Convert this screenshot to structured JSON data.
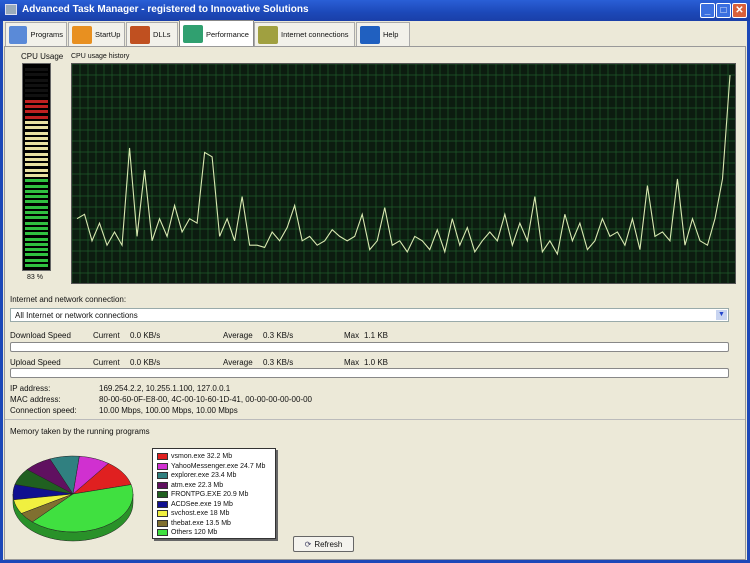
{
  "window": {
    "title": "Advanced Task Manager - registered to Innovative Solutions",
    "minimize": "_",
    "maximize": "□",
    "close": "✕"
  },
  "tabs": [
    {
      "label": "Programs",
      "icon": "window-icon",
      "color": "#5a8ad8"
    },
    {
      "label": "StartUp",
      "icon": "rocket-icon",
      "color": "#e89020"
    },
    {
      "label": "DLLs",
      "icon": "molecule-icon",
      "color": "#c05020"
    },
    {
      "label": "Performance",
      "icon": "bar-chart-icon",
      "color": "#30a070"
    },
    {
      "label": "Internet connections",
      "icon": "network-icon",
      "color": "#a0a040"
    },
    {
      "label": "Help",
      "icon": "book-icon",
      "color": "#2060c0"
    }
  ],
  "cpu": {
    "label": "CPU Usage",
    "value_text": "83 %",
    "value": 83,
    "history_label": "CPU usage history",
    "history": [
      30,
      32,
      20,
      28,
      18,
      24,
      18,
      62,
      22,
      52,
      20,
      30,
      22,
      36,
      24,
      30,
      28,
      60,
      58,
      22,
      30,
      20,
      40,
      18,
      18,
      17,
      24,
      20,
      26,
      36,
      20,
      22,
      18,
      20,
      25,
      22,
      20,
      22,
      32,
      16,
      20,
      35,
      18,
      20,
      15,
      22,
      20,
      16,
      25,
      15,
      30,
      18,
      26,
      15,
      20,
      24,
      20,
      32,
      18,
      28,
      20,
      40,
      15,
      20,
      14,
      32,
      20,
      28,
      16,
      20,
      30,
      22,
      24,
      18,
      30,
      16,
      45,
      22,
      24,
      20,
      48,
      18,
      30,
      20,
      18,
      30,
      48,
      95
    ]
  },
  "network": {
    "label": "Internet and network connection:",
    "selected": "All Internet or network connections",
    "download": {
      "label": "Download Speed",
      "current_label": "Current",
      "current": "0.0 KB/s",
      "average_label": "Average",
      "average": "0.3 KB/s",
      "max_label": "Max",
      "max": "1.1 KB",
      "progress": 0
    },
    "upload": {
      "label": "Upload Speed",
      "current_label": "Current",
      "current": "0.0 KB/s",
      "average_label": "Average",
      "average": "0.3 KB/s",
      "max_label": "Max",
      "max": "1.0 KB",
      "progress": 0
    },
    "ip_label": "IP address:",
    "ip": "169.254.2.2, 10.255.1.100, 127.0.0.1",
    "mac_label": "MAC address:",
    "mac": "80-00-60-0F-E8-00, 4C-00-10-60-1D-41, 00-00-00-00-00-00",
    "speed_label": "Connection speed:",
    "speed": "10.00 Mbps, 100.00 Mbps, 10.00 Mbps"
  },
  "memory": {
    "label": "Memory taken by the running programs",
    "refresh": "Refresh",
    "items": [
      {
        "label": "vsmon.exe 32.2 Mb",
        "value": 32.2,
        "color": "#e02020"
      },
      {
        "label": "YahooMessenger.exe 24.7 Mb",
        "value": 24.7,
        "color": "#d030d0"
      },
      {
        "label": "explorer.exe 23.4 Mb",
        "value": 23.4,
        "color": "#308080"
      },
      {
        "label": "atm.exe 22.3 Mb",
        "value": 22.3,
        "color": "#601060"
      },
      {
        "label": "FRONTPG.EXE 20.9 Mb",
        "value": 20.9,
        "color": "#206020"
      },
      {
        "label": "ACDSee.exe 19 Mb",
        "value": 19,
        "color": "#101090"
      },
      {
        "label": "svchost.exe 18 Mb",
        "value": 18,
        "color": "#f0f040"
      },
      {
        "label": "thebat.exe 13.5 Mb",
        "value": 13.5,
        "color": "#807030"
      },
      {
        "label": "Others 120 Mb",
        "value": 120,
        "color": "#40e040"
      }
    ]
  }
}
